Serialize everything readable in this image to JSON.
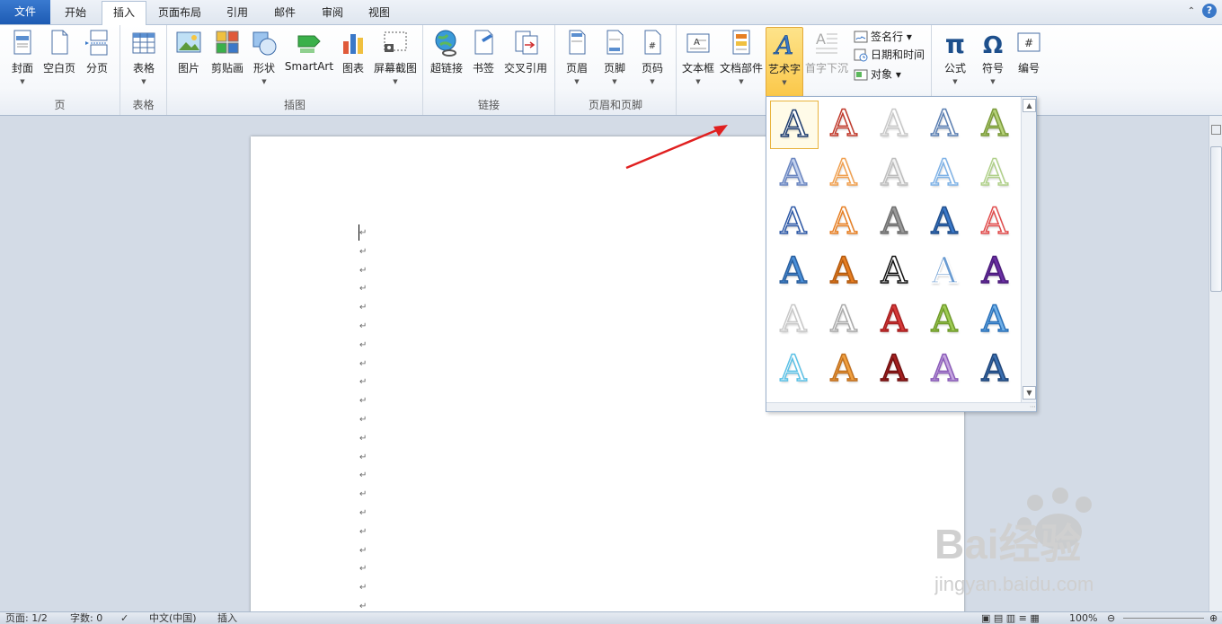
{
  "tabs": [
    {
      "label": "文件",
      "kind": "file"
    },
    {
      "label": "开始"
    },
    {
      "label": "插入",
      "active": true
    },
    {
      "label": "页面布局"
    },
    {
      "label": "引用"
    },
    {
      "label": "邮件"
    },
    {
      "label": "审阅"
    },
    {
      "label": "视图"
    }
  ],
  "help": {
    "caret": "⌃",
    "question": "?"
  },
  "ribbon": {
    "groups": {
      "page": "页",
      "table": "表格",
      "illustrations": "插图",
      "links": "链接",
      "header_footer": "页眉和页脚"
    },
    "buttons": {
      "cover": "封面",
      "blank": "空白页",
      "break": "分页",
      "table": "表格",
      "picture": "图片",
      "clipart": "剪贴画",
      "shapes": "形状",
      "smartart": "SmartArt",
      "chart": "图表",
      "screenshot": "屏幕截图",
      "hyperlink": "超链接",
      "bookmark": "书签",
      "crossref": "交叉引用",
      "header": "页眉",
      "footer": "页脚",
      "pagenum": "页码",
      "textbox": "文本框",
      "quickparts": "文档部件",
      "wordart": "艺术字",
      "dropcap": "首字下沉",
      "equation": "公式",
      "symbol": "符号",
      "number": "编号"
    },
    "small": {
      "signature": "签名行 ▾",
      "datetime": "日期和时间",
      "object": "对象 ▾"
    }
  },
  "gallery": {
    "letter": "A",
    "styles": [
      {
        "fill": "#ffffff",
        "stroke": "#1f3d6e"
      },
      {
        "fill": "#ffffff",
        "stroke": "#c0392b"
      },
      {
        "fill": "#ffffff",
        "stroke": "#c8c8c8"
      },
      {
        "fill": "#ffffff",
        "stroke": "#5b7fb2"
      },
      {
        "fill": "#b7d27a",
        "stroke": "#7a9a3a"
      },
      {
        "fill": "#c5d3ef",
        "stroke": "#6b86c0"
      },
      {
        "fill": "#ffffff",
        "stroke": "#f0a050"
      },
      {
        "fill": "#f2f2f2",
        "stroke": "#bdbdbd"
      },
      {
        "fill": "#ffffff",
        "stroke": "#7fb2e6"
      },
      {
        "fill": "#ffffff",
        "stroke": "#b0d08a"
      },
      {
        "fill": "#ffffff",
        "stroke": "#2d58a6"
      },
      {
        "fill": "#ffffff",
        "stroke": "#e67e22"
      },
      {
        "fill": "#9a9a9a",
        "stroke": "#6f6f6f"
      },
      {
        "fill": "#3a78c8",
        "stroke": "#214f8c"
      },
      {
        "fill": "#ffffff",
        "stroke": "#e04b4b"
      },
      {
        "fill": "#4a8fd8",
        "stroke": "#2a5f9e"
      },
      {
        "fill": "#e67e22",
        "stroke": "#b35a0f"
      },
      {
        "fill": "#ffffff",
        "stroke": "#111111"
      },
      {
        "fill": "#6a9bd1",
        "stroke": "#ffffff"
      },
      {
        "fill": "#6a2fa3",
        "stroke": "#4a1b7a"
      },
      {
        "fill": "#ffffff",
        "stroke": "#c8c8c8"
      },
      {
        "fill": "#ffffff",
        "stroke": "#aaaaaa"
      },
      {
        "fill": "#d73a3a",
        "stroke": "#a51f1f"
      },
      {
        "fill": "#9fcc55",
        "stroke": "#6f9a2a"
      },
      {
        "fill": "#6fb0e8",
        "stroke": "#2a70b8"
      },
      {
        "fill": "#ffffff",
        "stroke": "#5cc1e6"
      },
      {
        "fill": "#f0a040",
        "stroke": "#c07020"
      },
      {
        "fill": "#a52020",
        "stroke": "#701010"
      },
      {
        "fill": "#c6a6e0",
        "stroke": "#8a5cb8"
      },
      {
        "fill": "#3b6fb0",
        "stroke": "#20467a"
      }
    ]
  },
  "doc": {
    "para_mark": "↵"
  },
  "status": {
    "page": "页面: 1/2",
    "words": "字数: 0",
    "lang": "中文(中国)",
    "mode": "插入",
    "zoom": "100%"
  },
  "watermark": {
    "text": "Bai经验",
    "url": "jingyan.baidu.com"
  }
}
